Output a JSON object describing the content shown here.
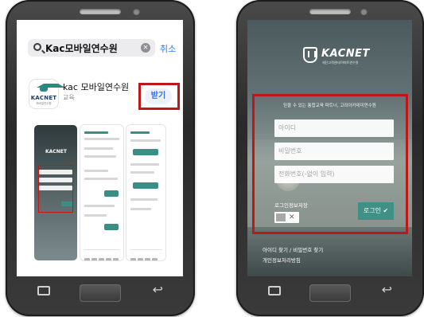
{
  "left_phone": {
    "search": {
      "query": "Kac모바일연수원",
      "cancel_label": "취소"
    },
    "app": {
      "name": "kac 모바일연수원",
      "category": "교육",
      "get_label": "받기",
      "icon_wordmark": "KACNET",
      "icon_subtitle": "모바일연수원"
    },
    "preview_screens": [
      "login",
      "course-list",
      "course-detail"
    ]
  },
  "right_phone": {
    "brand": {
      "name": "KACNET",
      "subtitle": "재단고객센터/아파트연수원"
    },
    "tagline": "믿을 수 있는 통합교육 파트너, 고려아카데미연수원",
    "fields": [
      {
        "placeholder": "아이디"
      },
      {
        "placeholder": "비밀번호"
      },
      {
        "placeholder": "전화번호(-없이 입력)"
      }
    ],
    "remember": {
      "label": "로그인정보저장",
      "checked": false
    },
    "login_label": "로그인 ✔",
    "links": [
      "아이디 찾기 / 비밀번호 찾기",
      "개인정보처리방침"
    ]
  },
  "colors": {
    "highlight": "#c0161a",
    "accent": "#3f9185",
    "link_blue": "#2d6fe0"
  },
  "icons": [
    "search-icon",
    "clear-icon",
    "graduation-cap-icon",
    "kacnet-logo-icon",
    "recent-apps-icon",
    "home-button-icon",
    "back-icon"
  ]
}
